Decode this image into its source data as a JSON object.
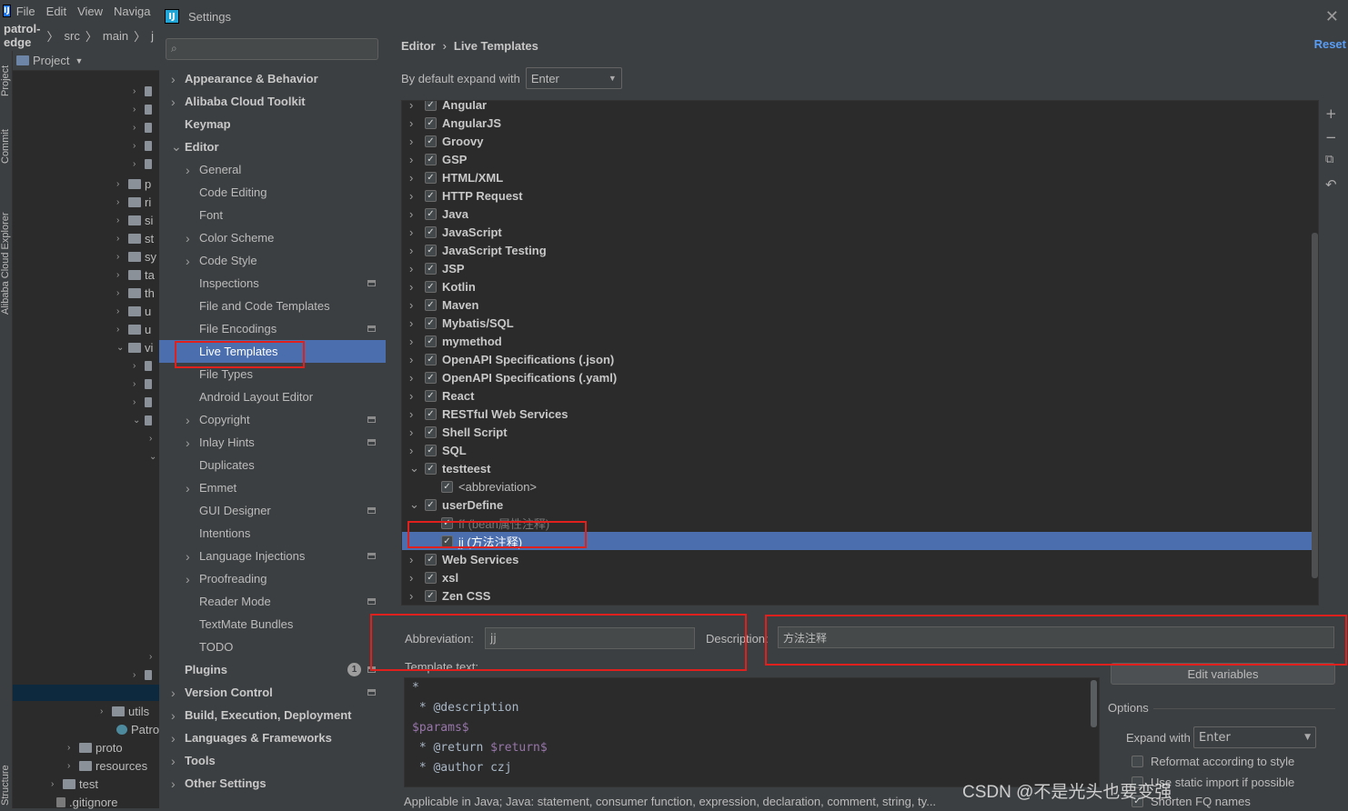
{
  "ide": {
    "menu": [
      "File",
      "Edit",
      "View",
      "Naviga"
    ],
    "breadcrumb": [
      "patrol-edge",
      "src",
      "main",
      "j"
    ],
    "vertical_tabs": [
      "Project",
      "Commit",
      "Alibaba Cloud Explorer",
      "Structure"
    ],
    "project_label": "Project",
    "tree_partial": [
      "p",
      "ri",
      "si",
      "st",
      "sy",
      "ta",
      "th",
      "u",
      "u",
      "vi"
    ],
    "tree_bottom": [
      "utils",
      "Patro",
      "proto",
      "resources",
      "test",
      ".gitignore"
    ]
  },
  "dialog": {
    "title": "Settings",
    "search_placeholder": "",
    "nav": [
      {
        "label": "Appearance & Behavior",
        "bold": true,
        "arrow": ">"
      },
      {
        "label": "Alibaba Cloud Toolkit",
        "bold": true,
        "arrow": ">"
      },
      {
        "label": "Keymap",
        "bold": true,
        "arrow": ""
      },
      {
        "label": "Editor",
        "bold": true,
        "arrow": "v"
      },
      {
        "label": "General",
        "indent": 1,
        "arrow": ">"
      },
      {
        "label": "Code Editing",
        "indent": 1,
        "arrow": ""
      },
      {
        "label": "Font",
        "indent": 1,
        "arrow": ""
      },
      {
        "label": "Color Scheme",
        "indent": 1,
        "arrow": ">"
      },
      {
        "label": "Code Style",
        "indent": 1,
        "arrow": ">"
      },
      {
        "label": "Inspections",
        "indent": 1,
        "arrow": "",
        "proj": true
      },
      {
        "label": "File and Code Templates",
        "indent": 1,
        "arrow": ""
      },
      {
        "label": "File Encodings",
        "indent": 1,
        "arrow": "",
        "proj": true
      },
      {
        "label": "Live Templates",
        "indent": 1,
        "arrow": "",
        "selected": true
      },
      {
        "label": "File Types",
        "indent": 1,
        "arrow": ""
      },
      {
        "label": "Android Layout Editor",
        "indent": 1,
        "arrow": ""
      },
      {
        "label": "Copyright",
        "indent": 1,
        "arrow": ">",
        "proj": true
      },
      {
        "label": "Inlay Hints",
        "indent": 1,
        "arrow": ">",
        "proj": true
      },
      {
        "label": "Duplicates",
        "indent": 1,
        "arrow": ""
      },
      {
        "label": "Emmet",
        "indent": 1,
        "arrow": ">"
      },
      {
        "label": "GUI Designer",
        "indent": 1,
        "arrow": "",
        "proj": true
      },
      {
        "label": "Intentions",
        "indent": 1,
        "arrow": ""
      },
      {
        "label": "Language Injections",
        "indent": 1,
        "arrow": ">",
        "proj": true
      },
      {
        "label": "Proofreading",
        "indent": 1,
        "arrow": ">"
      },
      {
        "label": "Reader Mode",
        "indent": 1,
        "arrow": "",
        "proj": true
      },
      {
        "label": "TextMate Bundles",
        "indent": 1,
        "arrow": ""
      },
      {
        "label": "TODO",
        "indent": 1,
        "arrow": ""
      },
      {
        "label": "Plugins",
        "bold": true,
        "arrow": "",
        "badge": "1",
        "proj": true
      },
      {
        "label": "Version Control",
        "bold": true,
        "arrow": ">",
        "proj": true
      },
      {
        "label": "Build, Execution, Deployment",
        "bold": true,
        "arrow": ">"
      },
      {
        "label": "Languages & Frameworks",
        "bold": true,
        "arrow": ">"
      },
      {
        "label": "Tools",
        "bold": true,
        "arrow": ">"
      },
      {
        "label": "Other Settings",
        "bold": true,
        "arrow": ">"
      }
    ],
    "breadcrumb": [
      "Editor",
      "Live Templates"
    ],
    "reset_label": "Reset",
    "expand_label": "By default expand with",
    "expand_value": "Enter",
    "template_groups": [
      {
        "label": "Angular",
        "level": 0,
        "arrow": ">"
      },
      {
        "label": "AngularJS",
        "level": 0,
        "arrow": ">"
      },
      {
        "label": "Groovy",
        "level": 0,
        "arrow": ">"
      },
      {
        "label": "GSP",
        "level": 0,
        "arrow": ">"
      },
      {
        "label": "HTML/XML",
        "level": 0,
        "arrow": ">"
      },
      {
        "label": "HTTP Request",
        "level": 0,
        "arrow": ">"
      },
      {
        "label": "Java",
        "level": 0,
        "arrow": ">"
      },
      {
        "label": "JavaScript",
        "level": 0,
        "arrow": ">"
      },
      {
        "label": "JavaScript Testing",
        "level": 0,
        "arrow": ">"
      },
      {
        "label": "JSP",
        "level": 0,
        "arrow": ">"
      },
      {
        "label": "Kotlin",
        "level": 0,
        "arrow": ">"
      },
      {
        "label": "Maven",
        "level": 0,
        "arrow": ">"
      },
      {
        "label": "Mybatis/SQL",
        "level": 0,
        "arrow": ">"
      },
      {
        "label": "mymethod",
        "level": 0,
        "arrow": ">"
      },
      {
        "label": "OpenAPI Specifications (.json)",
        "level": 0,
        "arrow": ">"
      },
      {
        "label": "OpenAPI Specifications (.yaml)",
        "level": 0,
        "arrow": ">"
      },
      {
        "label": "React",
        "level": 0,
        "arrow": ">"
      },
      {
        "label": "RESTful Web Services",
        "level": 0,
        "arrow": ">"
      },
      {
        "label": "Shell Script",
        "level": 0,
        "arrow": ">"
      },
      {
        "label": "SQL",
        "level": 0,
        "arrow": ">"
      },
      {
        "label": "testteest",
        "level": 0,
        "arrow": "v"
      },
      {
        "label": "<abbreviation>",
        "level": 1,
        "arrow": ""
      },
      {
        "label": "userDefine",
        "level": 0,
        "arrow": "v"
      },
      {
        "label": "ff (bean属性注释)",
        "level": 1,
        "arrow": "",
        "dim": true
      },
      {
        "label": "jj (方法注释)",
        "level": 1,
        "arrow": "",
        "selected": true
      },
      {
        "label": "Web Services",
        "level": 0,
        "arrow": ">"
      },
      {
        "label": "xsl",
        "level": 0,
        "arrow": ">"
      },
      {
        "label": "Zen CSS",
        "level": 0,
        "arrow": ">"
      }
    ],
    "side_buttons": [
      "+",
      "−",
      "⧉",
      "↶"
    ],
    "abbreviation_label": "Abbreviation:",
    "abbreviation_value": "jj",
    "description_label": "Description:",
    "description_value": "方法注释",
    "template_text_label": "Template text:",
    "template_lines": [
      {
        "a": "*",
        "b": "",
        "c": ""
      },
      {
        "a": " * @description",
        "b": "",
        "c": ""
      },
      {
        "a": "",
        "b": "$params$",
        "c": ""
      },
      {
        "a": " * @return ",
        "b": "$return$",
        "c": ""
      },
      {
        "a": " * @author czj",
        "b": "",
        "c": ""
      }
    ],
    "edit_variables_label": "Edit variables",
    "options_label": "Options",
    "expand_with_label": "Expand with",
    "expand_with_value": "Enter",
    "reformat_label": "Reformat according to style",
    "static_import_label": "Use static import if possible",
    "shorten_label": "Shorten FQ names",
    "applicable_text": "Applicable in Java; Java: statement, consumer function, expression, declaration, comment, string, ty...",
    "watermark": "CSDN @不是光头也要变强"
  },
  "colors": {
    "selection": "#4b6eaf",
    "highlight": "#e0201c",
    "link": "#589df6"
  }
}
